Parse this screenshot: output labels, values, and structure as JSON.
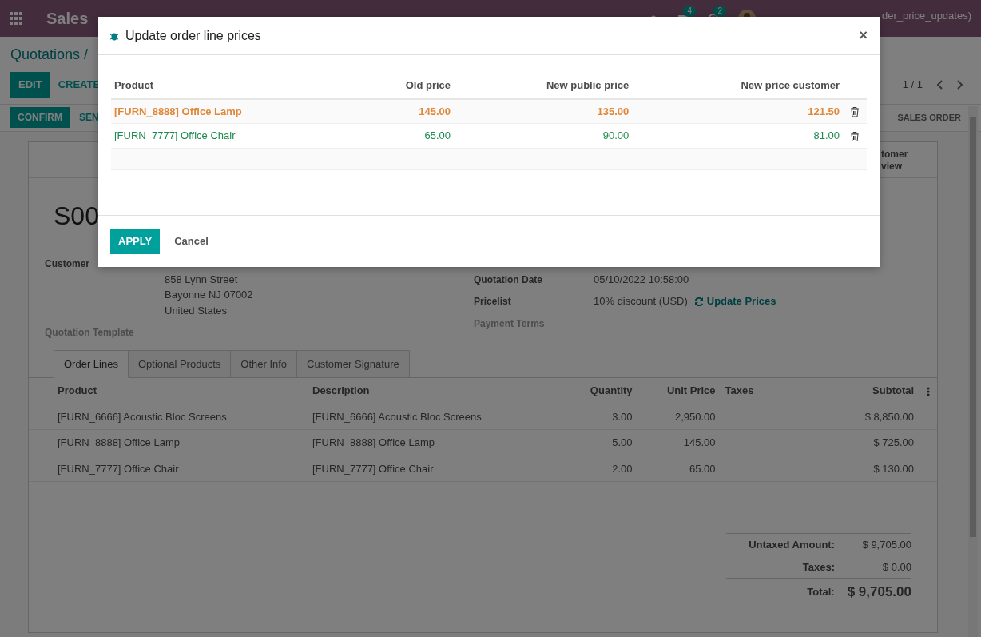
{
  "navbar": {
    "app": "Sales",
    "chat_count": "4",
    "activity_count": "2",
    "user": "der_price_updates)"
  },
  "breadcrumb": "Quotations /",
  "actions": [
    "EDIT",
    "CREATE"
  ],
  "pager": "1 / 1",
  "status_buttons": [
    {
      "label": "CONFIRM",
      "kind": "primary"
    },
    {
      "label": "SEN",
      "kind": "secondary"
    }
  ],
  "stages": [
    {
      "label": "SALES ORDER",
      "selected": false
    }
  ],
  "smart_button": {
    "lines": [
      "tomer",
      "view"
    ]
  },
  "record": {
    "name": "S00",
    "fields_left": [
      {
        "label": "Customer",
        "empty": false,
        "value_lines": [
          "858 Lynn Street",
          "Bayonne NJ 07002",
          "United States"
        ]
      },
      {
        "label": "Quotation Template",
        "empty": true
      }
    ],
    "fields_right": [
      {
        "label": "Quotation Date",
        "empty": false,
        "value": "05/10/2022 10:58:00"
      },
      {
        "label": "Pricelist",
        "empty": false,
        "value": "10% discount (USD)",
        "action": "Update Prices"
      },
      {
        "label": "Payment Terms",
        "empty": true
      }
    ]
  },
  "tabs": [
    {
      "label": "Order Lines",
      "selected": true
    },
    {
      "label": "Optional Products",
      "selected": false
    },
    {
      "label": "Other Info",
      "selected": false
    },
    {
      "label": "Customer Signature",
      "selected": false
    }
  ],
  "lines": {
    "columns": [
      "Product",
      "Description",
      "Quantity",
      "Unit Price",
      "Taxes",
      "Subtotal"
    ],
    "rows": [
      [
        "[FURN_6666] Acoustic Bloc Screens",
        "[FURN_6666] Acoustic Bloc Screens",
        "3.00",
        "2,950.00",
        "",
        "$ 8,850.00"
      ],
      [
        "[FURN_8888] Office Lamp",
        "[FURN_8888] Office Lamp",
        "5.00",
        "145.00",
        "",
        "$ 725.00"
      ],
      [
        "[FURN_7777] Office Chair",
        "[FURN_7777] Office Chair",
        "2.00",
        "65.00",
        "",
        "$ 130.00"
      ]
    ]
  },
  "totals": [
    {
      "label": "Untaxed Amount:",
      "value": "$ 9,705.00",
      "kind": "sub"
    },
    {
      "label": "Taxes:",
      "value": "$ 0.00",
      "kind": "sub"
    },
    {
      "label": "Total:",
      "value": "$ 9,705.00",
      "kind": "grand"
    }
  ],
  "dialog": {
    "title": "Update order line prices",
    "close": "×",
    "columns": [
      "Product",
      "Old price",
      "New public price",
      "New price customer"
    ],
    "rows": [
      {
        "product": "[FURN_8888] Office Lamp",
        "old_price": "145.00",
        "new_public_price": "135.00",
        "new_price_customer": "121.50",
        "kind": "warning"
      },
      {
        "product": "[FURN_7777] Office Chair",
        "old_price": "65.00",
        "new_public_price": "90.00",
        "new_price_customer": "81.00",
        "kind": "success"
      }
    ],
    "buttons": [
      {
        "label": "APPLY",
        "kind": "primary"
      },
      {
        "label": "Cancel",
        "kind": "secondary"
      }
    ]
  }
}
